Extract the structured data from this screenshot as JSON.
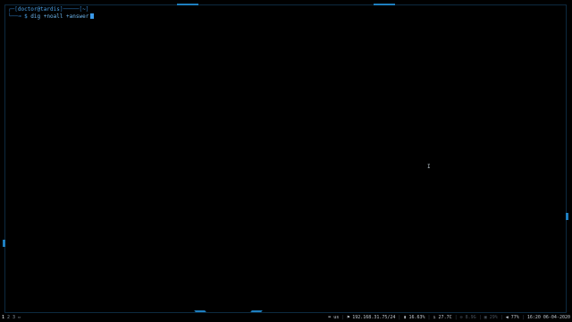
{
  "terminal": {
    "line1": {
      "open": "┌─[",
      "user": "doctor",
      "at": "@",
      "host": "tardis",
      "mid": "]─────[",
      "path": "~",
      "close": "]"
    },
    "line2": {
      "lead": "└──╼ ",
      "dollar": "$",
      "command": " dig +noall +answer"
    }
  },
  "pointer": {
    "glyph": "I"
  },
  "statusbar": {
    "workspaces": [
      "1",
      "2",
      "3"
    ],
    "active_workspace": "1",
    "folder_icon": "folder-icon",
    "layout": "us",
    "network": "192.168.31.75/24",
    "cpu": "16.63%",
    "temp": "27.7C",
    "disk": "8.9G",
    "memory": "29%",
    "volume": "77%",
    "datetime": "16:20 06-04-2020"
  },
  "colors": {
    "background": "#000000",
    "accent": "#1e7fc0",
    "prompt": "#4aa3ea"
  }
}
